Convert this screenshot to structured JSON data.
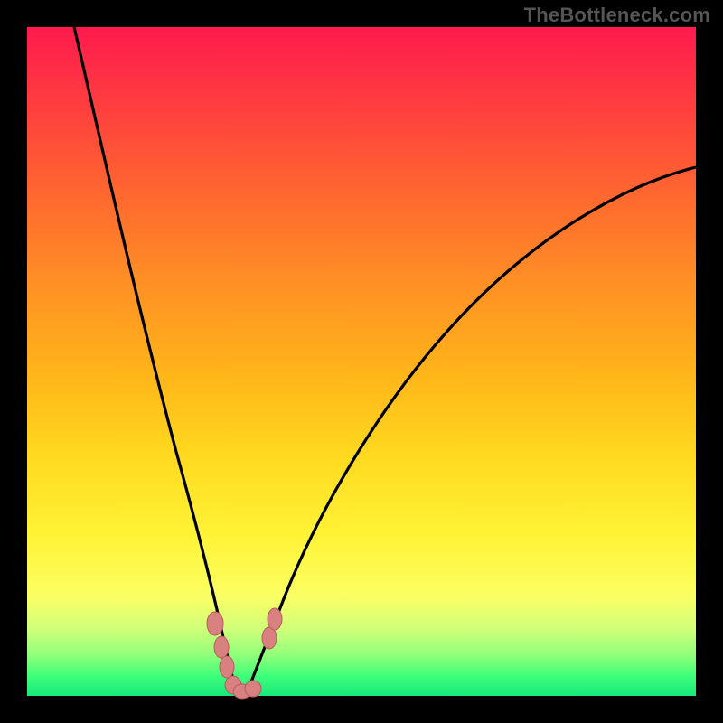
{
  "watermark": {
    "text": "TheBottleneck.com"
  },
  "colors": {
    "frame": "#000000",
    "curve_stroke": "#000000",
    "marker_fill": "#d98080",
    "marker_stroke": "#b85c5c",
    "gradient_stops": [
      "#ff1a4d",
      "#ff3f3f",
      "#ff6a2e",
      "#ff8f25",
      "#ffb519",
      "#ffd91f",
      "#fff336",
      "#fbff63",
      "#d1ff7a",
      "#8fff7a",
      "#3fff7a",
      "#17e87a"
    ]
  },
  "chart_data": {
    "type": "line",
    "title": "",
    "xlabel": "",
    "ylabel": "",
    "xlim": [
      0,
      100
    ],
    "ylim": [
      0,
      100
    ],
    "grid": false,
    "legend": false,
    "x": [
      7,
      10,
      13,
      16,
      19,
      22,
      24,
      26,
      27.5,
      29,
      30,
      31,
      32,
      33,
      34,
      36,
      39,
      43,
      48,
      55,
      62,
      70,
      78,
      86,
      94,
      100
    ],
    "values": [
      100,
      92,
      82,
      72,
      61,
      49,
      38,
      26,
      15,
      7,
      2,
      0,
      0,
      2,
      6,
      13,
      23,
      34,
      45,
      55,
      63,
      69,
      73,
      76,
      78,
      79
    ],
    "minimum_x": 31.5,
    "annotations": [
      {
        "type": "marker-cluster",
        "approx_x_range": [
          27,
          36
        ],
        "approx_y_range": [
          0,
          12
        ]
      }
    ]
  }
}
